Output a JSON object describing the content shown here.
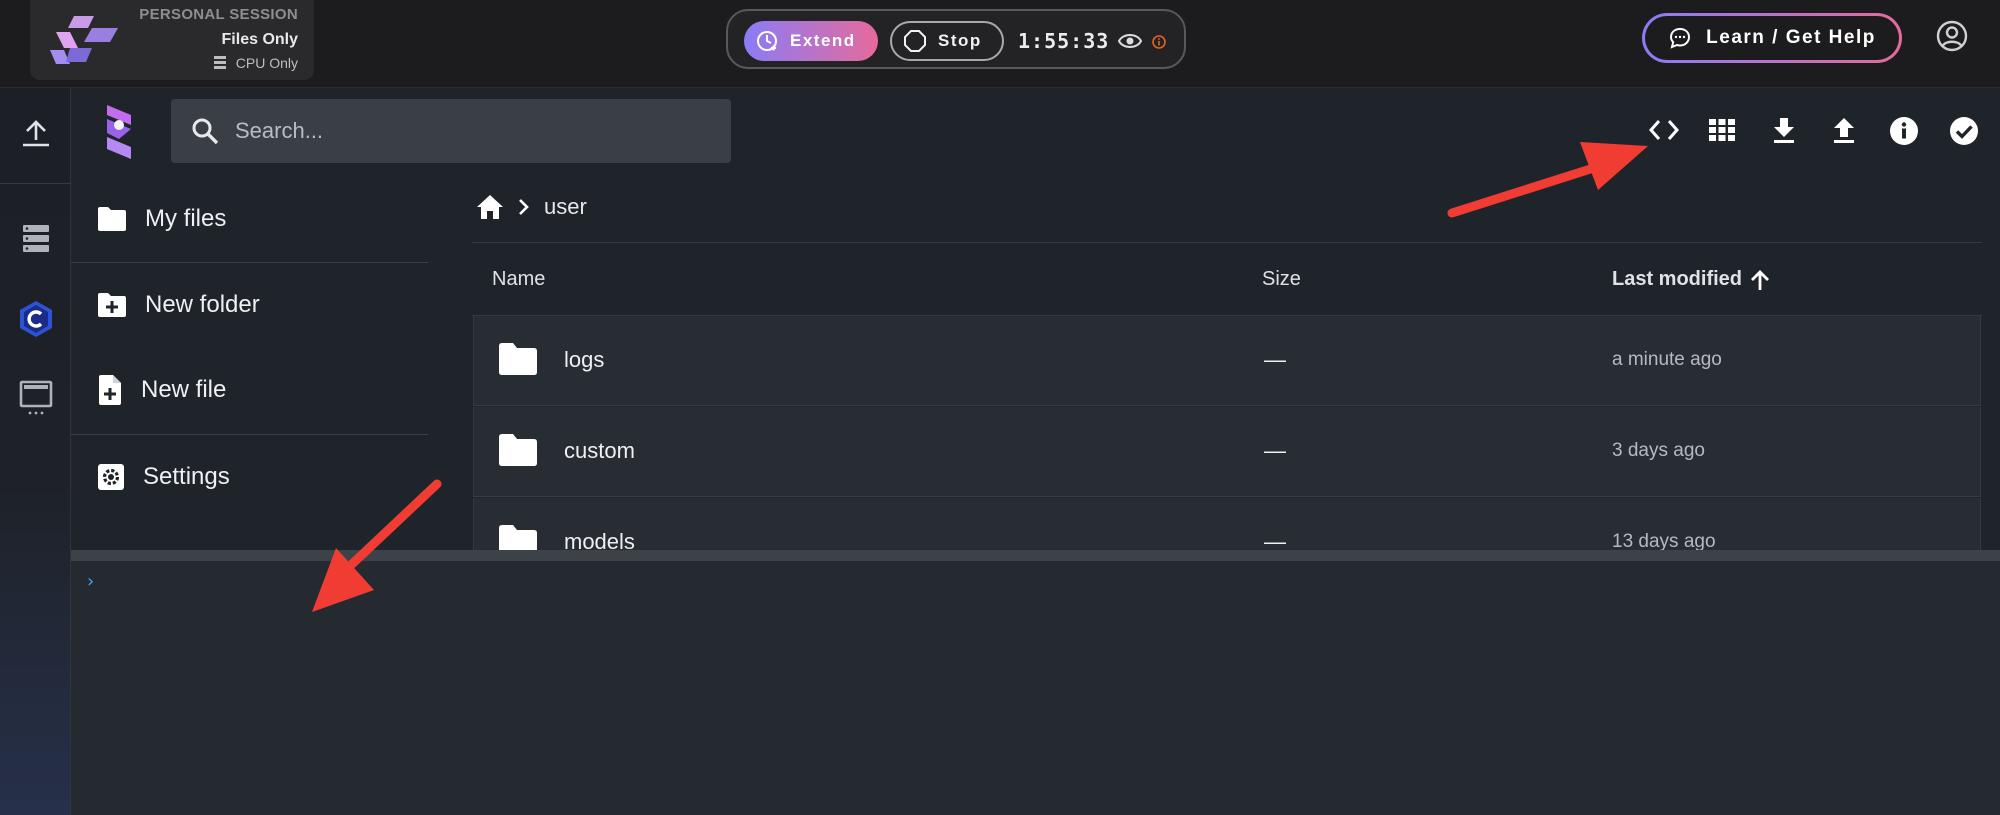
{
  "session": {
    "title": "PERSONAL SESSION",
    "subtitle": "Files Only",
    "resource": "CPU Only"
  },
  "controls": {
    "extend_label": "Extend",
    "stop_label": "Stop",
    "timer": "1:55:33"
  },
  "help_label": "Learn / Get Help",
  "search": {
    "placeholder": "Search..."
  },
  "toolbar_icons": [
    "code-view-icon",
    "grid-view-icon",
    "download-icon",
    "upload-icon",
    "info-icon",
    "select-check-icon"
  ],
  "rail_icons": [
    "upload-icon",
    "server-list-icon",
    "c-hex-icon",
    "monitor-icon"
  ],
  "menu": {
    "my_files": "My files",
    "new_folder": "New folder",
    "new_file": "New file",
    "settings": "Settings"
  },
  "breadcrumb": {
    "current": "user"
  },
  "columns": {
    "name": "Name",
    "size": "Size",
    "modified": "Last modified"
  },
  "files": [
    {
      "name": "logs",
      "size": "—",
      "modified": "a minute ago"
    },
    {
      "name": "custom",
      "size": "—",
      "modified": "3 days ago"
    },
    {
      "name": "models",
      "size": "—",
      "modified": "13 days ago"
    }
  ],
  "terminal": {
    "prompt": "›"
  },
  "colors": {
    "accent_gradient_start": "#8a7cf6",
    "accent_gradient_end": "#e66a9c",
    "annotation_arrow": "#f03c33",
    "terminal_prompt": "#3fa7f5"
  }
}
